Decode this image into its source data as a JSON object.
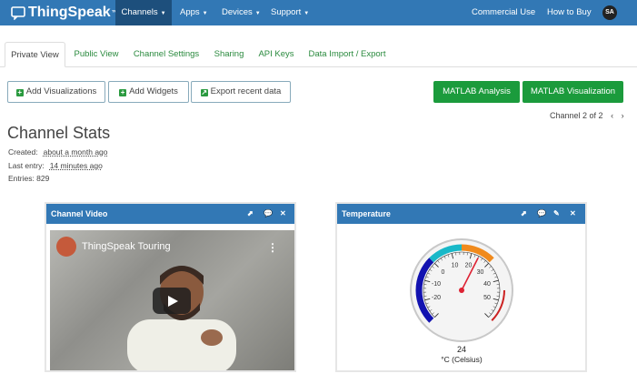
{
  "nav": {
    "brand": "ThingSpeak",
    "tm": "™",
    "items": [
      {
        "label": "Channels"
      },
      {
        "label": "Apps"
      },
      {
        "label": "Devices"
      },
      {
        "label": "Support"
      }
    ],
    "right": [
      {
        "label": "Commercial Use"
      },
      {
        "label": "How to Buy"
      }
    ],
    "avatar": "SA"
  },
  "tabs": [
    {
      "label": "Private View"
    },
    {
      "label": "Public View"
    },
    {
      "label": "Channel Settings"
    },
    {
      "label": "Sharing"
    },
    {
      "label": "API Keys"
    },
    {
      "label": "Data Import / Export"
    }
  ],
  "toolbar": {
    "add_visualizations": "Add Visualizations",
    "add_widgets": "Add Widgets",
    "export_recent": "Export recent data",
    "matlab_analysis": "MATLAB Analysis",
    "matlab_visualization": "MATLAB Visualization"
  },
  "pager": {
    "text": "Channel 2 of 2",
    "prev": "‹",
    "next": "›"
  },
  "stats": {
    "title": "Channel Stats",
    "created_label": "Created:",
    "created_value": "about a month ago",
    "last_entry_label": "Last entry:",
    "last_entry_value": "14 minutes ago",
    "entries": "Entries: 829"
  },
  "video_widget": {
    "title": "Channel Video",
    "video_title": "ThingSpeak Touring"
  },
  "gauge_widget": {
    "title": "Temperature",
    "value": 24,
    "value_text": "24",
    "unit_text": "°C (Celsius)",
    "min": -30,
    "max": 60,
    "ticks": [
      "-20",
      "-10",
      "0",
      "10",
      "20",
      "30",
      "40",
      "50"
    ],
    "colors": {
      "cold": "#1212b0",
      "cool": "#18b8c8",
      "warm": "#f08a1c",
      "hot": "#cc2222"
    }
  },
  "colors": {
    "nav": "#3278b5",
    "nav_active": "#1d4f7c",
    "green": "#1b9b3c",
    "link_green": "#2a8a3e"
  }
}
